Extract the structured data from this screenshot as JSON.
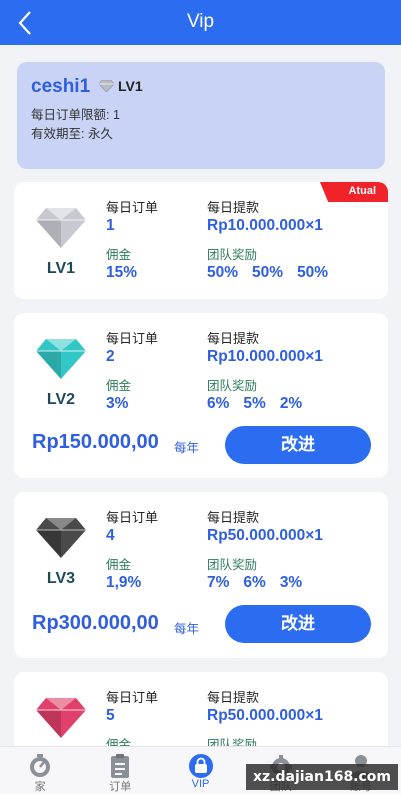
{
  "header": {
    "title": "Vip"
  },
  "user": {
    "name": "ceshi1",
    "level": "LV1",
    "daily_order_limit": "每日订单限额: 1",
    "valid_until": "有效期至: 永久"
  },
  "labels": {
    "daily_orders": "每日订单",
    "daily_withdraw": "每日提款",
    "commission": "佣金",
    "team_reward": "团队奖励",
    "per_year": "每年",
    "upgrade": "改进",
    "current_badge": "Atual"
  },
  "levels": [
    {
      "name": "LV1",
      "gem_color": "#c8c8d0",
      "daily_orders": "1",
      "daily_withdraw": "Rp10.000.000×1",
      "commission": "15%",
      "team_rewards": [
        "50%",
        "50%",
        "50%"
      ],
      "current": true
    },
    {
      "name": "LV2",
      "gem_color": "#33c6c6",
      "daily_orders": "2",
      "daily_withdraw": "Rp10.000.000×1",
      "commission": "3%",
      "team_rewards": [
        "6%",
        "5%",
        "2%"
      ],
      "price": "Rp150.000,00"
    },
    {
      "name": "LV3",
      "gem_color": "#4a4a4a",
      "daily_orders": "4",
      "daily_withdraw": "Rp50.000.000×1",
      "commission": "1,9%",
      "team_rewards": [
        "7%",
        "6%",
        "3%"
      ],
      "price": "Rp300.000,00"
    },
    {
      "name": "LV4",
      "gem_color": "#e0406a",
      "daily_orders": "5",
      "daily_withdraw": "Rp50.000.000×1"
    }
  ],
  "tabs": [
    {
      "label": "家",
      "icon": "home-icon"
    },
    {
      "label": "订单",
      "icon": "order-icon"
    },
    {
      "label": "VIP",
      "icon": "vip-icon",
      "active": true
    },
    {
      "label": "团队",
      "icon": "team-icon"
    },
    {
      "label": "账号",
      "icon": "account-icon"
    }
  ],
  "watermark": "xz.dajian168.com",
  "colors": {
    "primary": "#2b6cf0",
    "accent_text": "#2f5fe0",
    "badge": "#f0222a",
    "user_card": "#c8d3f5"
  }
}
